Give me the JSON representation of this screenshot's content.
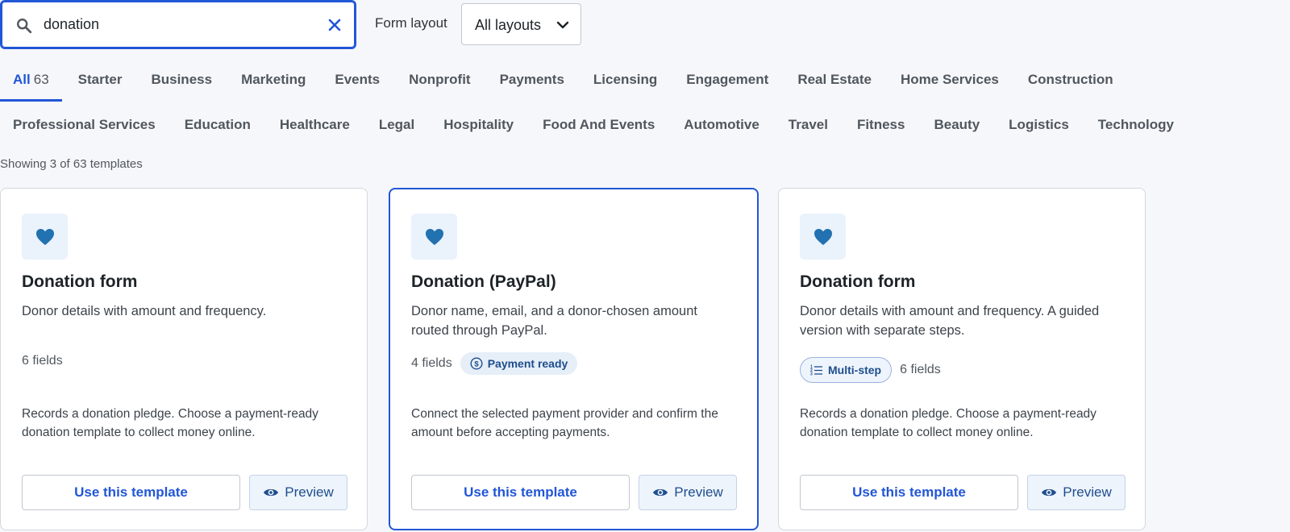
{
  "search": {
    "value": "donation"
  },
  "layout_filter": {
    "label": "Form layout",
    "selected": "All layouts"
  },
  "tabs_row1": [
    {
      "label": "All",
      "count": "63",
      "active": true
    },
    {
      "label": "Starter"
    },
    {
      "label": "Business"
    },
    {
      "label": "Marketing"
    },
    {
      "label": "Events"
    },
    {
      "label": "Nonprofit"
    },
    {
      "label": "Payments"
    },
    {
      "label": "Licensing"
    },
    {
      "label": "Engagement"
    },
    {
      "label": "Real Estate"
    },
    {
      "label": "Home Services"
    },
    {
      "label": "Construction"
    }
  ],
  "tabs_row2": [
    {
      "label": "Professional Services"
    },
    {
      "label": "Education"
    },
    {
      "label": "Healthcare"
    },
    {
      "label": "Legal"
    },
    {
      "label": "Hospitality"
    },
    {
      "label": "Food And Events"
    },
    {
      "label": "Automotive"
    },
    {
      "label": "Travel"
    },
    {
      "label": "Fitness"
    },
    {
      "label": "Beauty"
    },
    {
      "label": "Logistics"
    },
    {
      "label": "Technology"
    }
  ],
  "results_text": "Showing 3 of 63 templates",
  "cards": [
    {
      "title": "Donation form",
      "description": "Donor details with amount and frequency.",
      "fields": "6 fields",
      "note": "Records a donation pledge. Choose a payment-ready donation template to collect money online.",
      "use_label": "Use this template",
      "preview_label": "Preview"
    },
    {
      "title": "Donation (PayPal)",
      "description": "Donor name, email, and a donor-chosen amount routed through PayPal.",
      "fields": "4 fields",
      "badge": "Payment ready",
      "note": "Connect the selected payment provider and confirm the amount before accepting payments.",
      "use_label": "Use this template",
      "preview_label": "Preview"
    },
    {
      "title": "Donation form",
      "description": "Donor details with amount and frequency. A guided version with separate steps.",
      "badge": "Multi-step",
      "fields": "6 fields",
      "note": "Records a donation pledge. Choose a payment-ready donation template to collect money online.",
      "use_label": "Use this template",
      "preview_label": "Preview"
    }
  ],
  "colors": {
    "accent": "#2156d6",
    "heart": "#2271b1",
    "badge_text": "#1e4e8c"
  }
}
